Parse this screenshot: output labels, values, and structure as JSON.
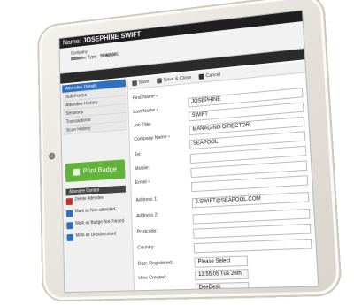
{
  "header": {
    "prefix": "Name:",
    "name": "JOSEPHINE SWIFT"
  },
  "info": {
    "company_label": "Company Name:",
    "company_value": "SEAPOOL",
    "type_label": "Attendee Type:",
    "type_value": "Delegate"
  },
  "sidebar": {
    "items": [
      {
        "label": "Attendee Details"
      },
      {
        "label": "Sub-Forms"
      },
      {
        "label": "Attendee History"
      },
      {
        "label": "Sessions"
      },
      {
        "label": "Transactions"
      },
      {
        "label": "Scan History"
      }
    ],
    "print_badge": "Print Badge",
    "control_header": "Attendee Control",
    "controls": [
      {
        "label": "Delete Attendee"
      },
      {
        "label": "Mark as Non-attended"
      },
      {
        "label": "Mark as Badge Not Printed"
      },
      {
        "label": "Mark as Unsubscribed"
      }
    ]
  },
  "toolbar": {
    "save": "Save",
    "save_close": "Save & Close",
    "cancel": "Cancel"
  },
  "form": {
    "fields": [
      {
        "label": "First Name",
        "required": "•",
        "value": "JOSEPHINE"
      },
      {
        "label": "Last Name",
        "required": "•",
        "value": "SWIFT"
      },
      {
        "label": "Job Title:",
        "required": "",
        "value": "MANAGING DIRECTOR"
      },
      {
        "label": "Company Name",
        "required": "•",
        "value": "SEAPOOL"
      },
      {
        "label": "Tel:",
        "required": "",
        "value": ""
      },
      {
        "label": "Mobile:",
        "required": "",
        "value": ""
      },
      {
        "label": "Email",
        "required": "•",
        "value": ""
      },
      {
        "label": "Address 1:",
        "required": "",
        "value": "J.SWIFT@SEAPOOL.COM"
      },
      {
        "label": "Address 2:",
        "required": "",
        "value": ""
      },
      {
        "label": "Postcode:",
        "required": "",
        "value": ""
      },
      {
        "label": "Country:",
        "required": "",
        "value": ""
      },
      {
        "label": "Date Registered:",
        "required": "",
        "value": "Please Select"
      },
      {
        "label": "How Created:",
        "required": "",
        "value": "13:55:05 Tue 26th"
      },
      {
        "label": "",
        "required": "",
        "value": "DeeDesk"
      }
    ]
  },
  "colors": {
    "accent": "#2f6fc0",
    "print_badge": "#62b33a",
    "header": "#1f1f1f"
  }
}
